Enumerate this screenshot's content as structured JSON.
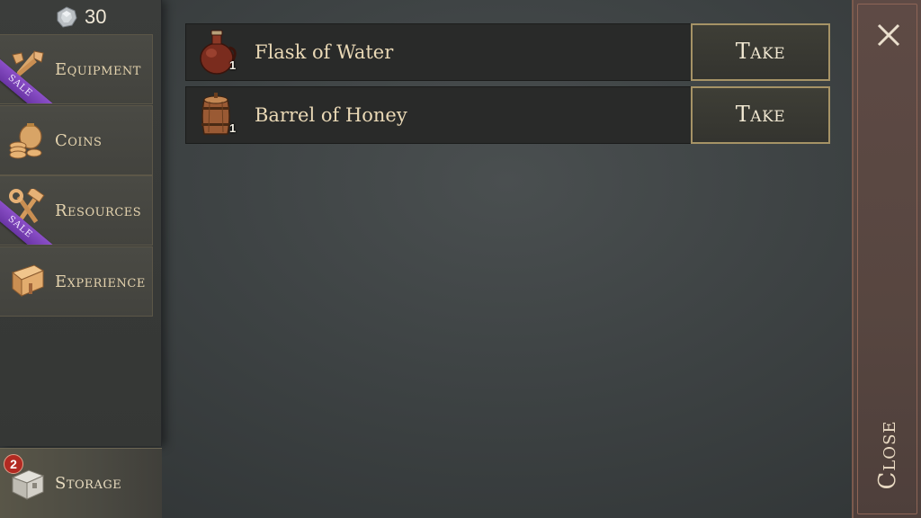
{
  "currency": {
    "value": "30",
    "icon": "silver-gem-icon"
  },
  "sidebar": {
    "items": [
      {
        "label": "Equipment",
        "icon": "sword-axe-icon",
        "sale": "SALE"
      },
      {
        "label": "Coins",
        "icon": "coin-bag-icon"
      },
      {
        "label": "Resources",
        "icon": "hammer-wrench-icon",
        "sale": "SALE"
      },
      {
        "label": "Experience",
        "icon": "book-icon"
      }
    ],
    "storage": {
      "label": "Storage",
      "badge": "2",
      "icon": "chest-icon"
    }
  },
  "items": [
    {
      "name": "Flask of Water",
      "qty": "1",
      "icon": "flask-icon",
      "action": "Take"
    },
    {
      "name": "Barrel of Honey",
      "qty": "1",
      "icon": "barrel-icon",
      "action": "Take"
    }
  ],
  "close": {
    "label": "Close",
    "icon": "close-icon"
  },
  "colors": {
    "accent_gold": "#a69366",
    "sale_purple": "#7b42b8",
    "badge_red": "#b22a22"
  }
}
